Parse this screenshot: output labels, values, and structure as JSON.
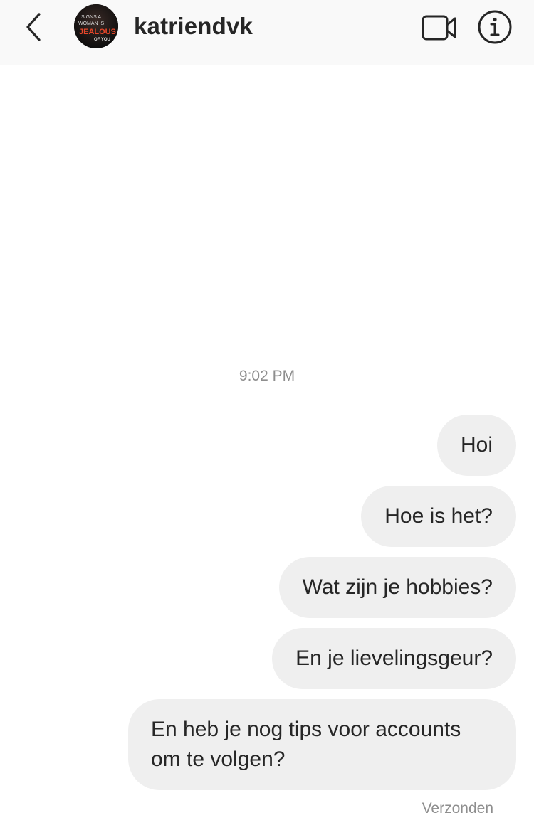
{
  "header": {
    "back_icon": "chevron-left-icon",
    "username": "katriendvk",
    "avatar": {
      "lines": [
        "SIGNS A",
        "WOMAN IS",
        "JEALOUS",
        "OF YOU"
      ]
    },
    "video_icon": "video-camera-icon",
    "info_icon": "info-icon"
  },
  "conversation": {
    "timestamp": "9:02 PM",
    "messages": [
      {
        "text": "Hoi"
      },
      {
        "text": "Hoe is het?"
      },
      {
        "text": "Wat zijn je hobbies?"
      },
      {
        "text": "En je lievelingsgeur?"
      },
      {
        "text": "En heb je nog tips voor accounts om te volgen?"
      }
    ],
    "status": "Verzonden"
  },
  "colors": {
    "header_bg": "#f9f9f9",
    "bubble_bg": "#efefef",
    "text": "#262626",
    "muted": "#8e8e8e",
    "avatar_accent": "#e8472a"
  }
}
